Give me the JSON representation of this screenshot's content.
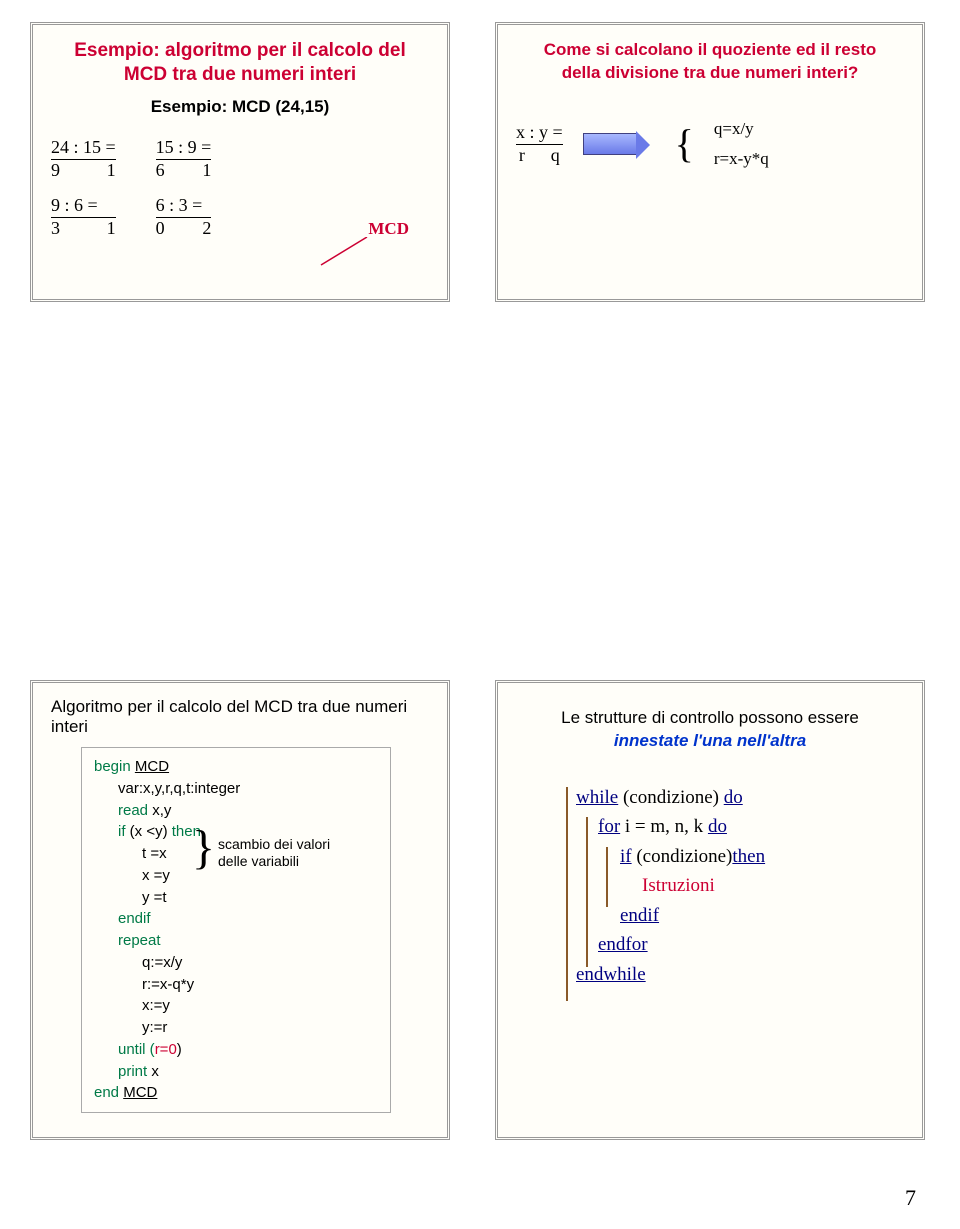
{
  "slide1": {
    "title_l1": "Esempio: algoritmo per il calcolo del",
    "title_l2": "MCD tra due numeri interi",
    "subtitle": "Esempio: MCD (24,15)",
    "divisions": [
      {
        "top": "24 : 15 =",
        "r": "9",
        "q": "1"
      },
      {
        "top": "9 :  6 =",
        "r": "3",
        "q": "1"
      },
      {
        "top": "15 :  9 =",
        "r": "6",
        "q": "1"
      },
      {
        "top": "6 :  3 =",
        "r": "0",
        "q": "2"
      }
    ],
    "mcd_label": "MCD"
  },
  "slide2": {
    "title_l1": "Come si calcolano il quoziente ed il resto",
    "title_l2": "della divisione tra due numeri interi?",
    "xy_top": "x :   y =",
    "xy_r": "r",
    "xy_q": "q",
    "eq_q": "q=x/y",
    "eq_r": "r=x-y*q"
  },
  "slide3": {
    "title": "Algoritmo per il calcolo del MCD tra due numeri interi",
    "lines": {
      "begin": "begin ",
      "mcd": "MCD",
      "var": "var:x,y,r,q,t:integer",
      "read": "read x,y",
      "if": "if (x <y) then",
      "tx": "t =x",
      "xy": "x =y",
      "yt": "y =t",
      "endif": "endif",
      "repeat": "repeat",
      "q": "q:=x/y",
      "r": "r:=x-q*y",
      "xx": "x:=y",
      "yy": "y:=r",
      "until": "until (",
      "r0": "r=0",
      "close": ")",
      "print": "print x",
      "end": "end ",
      "mcd2": "MCD"
    },
    "annot1": "scambio dei valori",
    "annot2": "delle variabili"
  },
  "slide4": {
    "title_l1": "Le strutture di controllo possono essere",
    "title_l2": "innestate l'una nell'altra",
    "code": {
      "while1": "while",
      "while2": " (condizione) ",
      "do": "do",
      "for1": "for",
      "for2": " i = m, n, k ",
      "do2": "do",
      "if1": "if",
      "if2": " (condizione)",
      "then": "then",
      "instr": "Istruzioni",
      "endif": "endif",
      "endfor": "endfor",
      "endwhile": "endwhile"
    }
  },
  "page_number": "7"
}
